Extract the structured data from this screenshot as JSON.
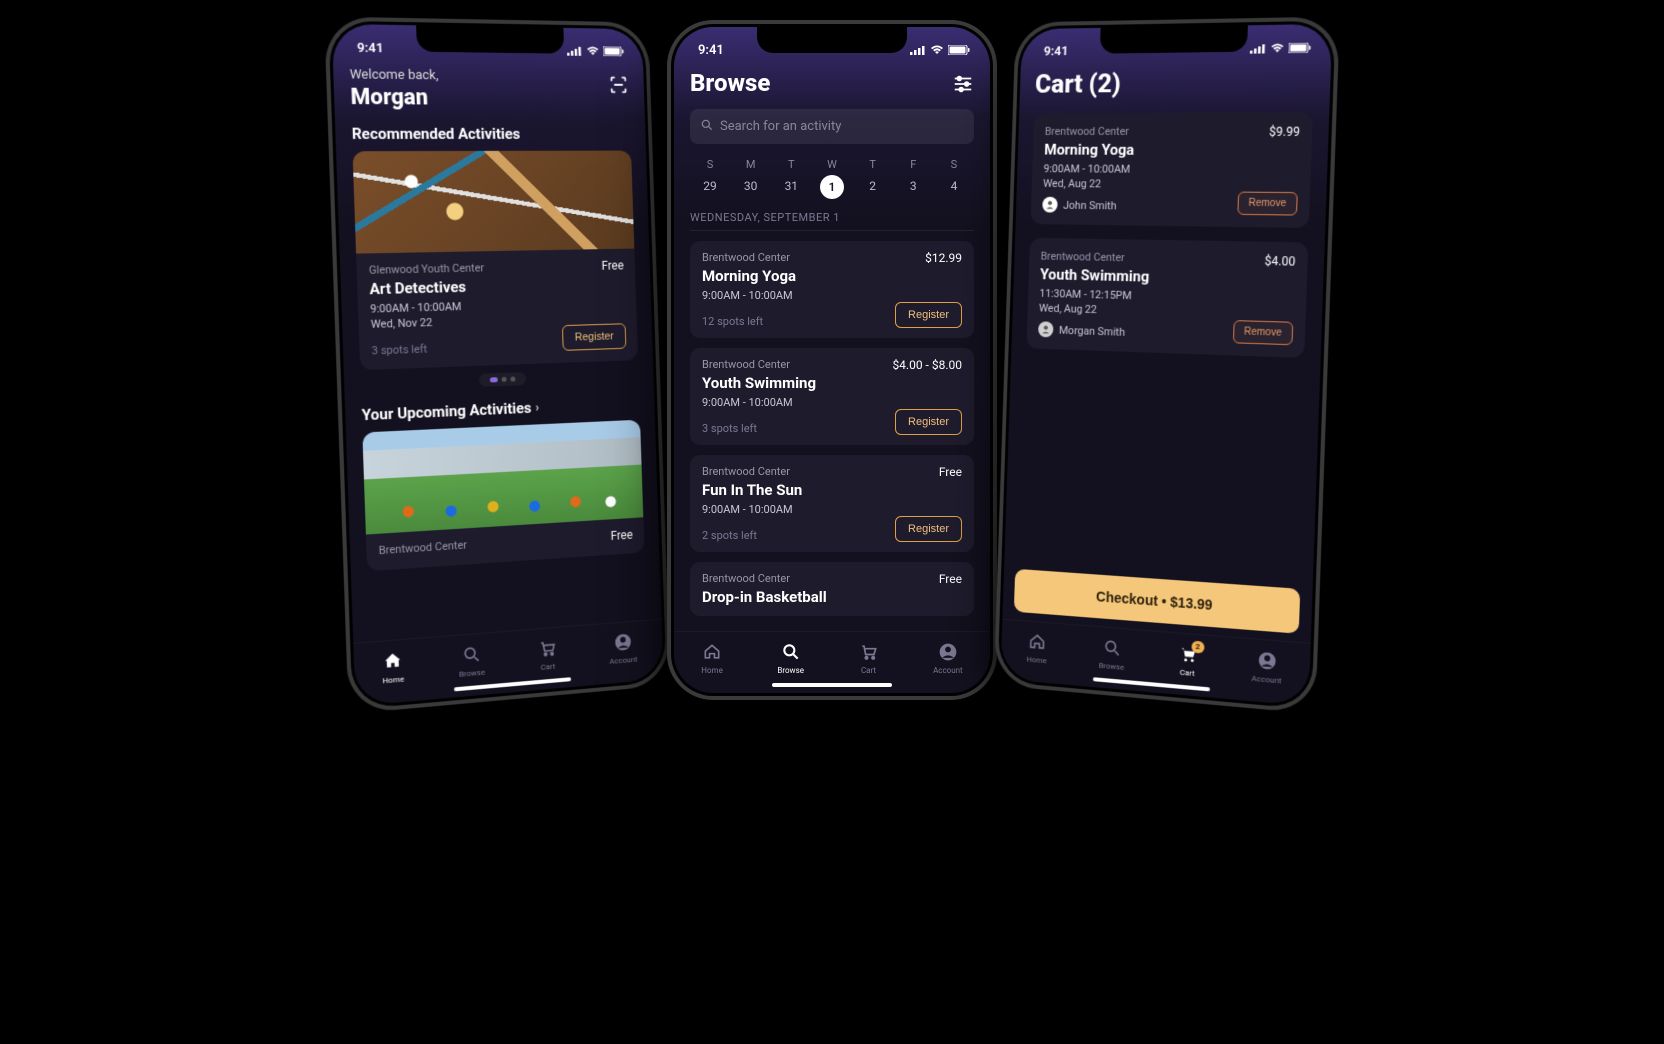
{
  "status": {
    "time": "9:41"
  },
  "tabs": {
    "home": "Home",
    "browse": "Browse",
    "cart": "Cart",
    "account": "Account",
    "cart_badge": "2"
  },
  "home": {
    "welcome": "Welcome back,",
    "name": "Morgan",
    "recommended_title": "Recommended Activities",
    "upcoming_title": "Your Upcoming Activities",
    "card1": {
      "location": "Glenwood Youth Center",
      "price": "Free",
      "title": "Art Detectives",
      "time": "9:00AM - 10:00AM",
      "date": "Wed, Nov 22",
      "spots": "3 spots left",
      "register": "Register"
    },
    "card2": {
      "location": "Brentwood Center",
      "price": "Free"
    }
  },
  "browse": {
    "title": "Browse",
    "search_placeholder": "Search for an activity",
    "weekdays": [
      "S",
      "M",
      "T",
      "W",
      "T",
      "F",
      "S"
    ],
    "days": [
      "29",
      "30",
      "31",
      "1",
      "2",
      "3",
      "4"
    ],
    "selected_index": 3,
    "date_header": "WEDNESDAY, SEPTEMBER 1",
    "items": [
      {
        "location": "Brentwood Center",
        "price": "$12.99",
        "title": "Morning Yoga",
        "time": "9:00AM - 10:00AM",
        "spots": "12 spots left",
        "register": "Register"
      },
      {
        "location": "Brentwood Center",
        "price": "$4.00 - $8.00",
        "title": "Youth Swimming",
        "time": "9:00AM - 10:00AM",
        "spots": "3 spots left",
        "register": "Register"
      },
      {
        "location": "Brentwood Center",
        "price": "Free",
        "title": "Fun In The Sun",
        "time": "9:00AM - 10:00AM",
        "spots": "2 spots left",
        "register": "Register"
      },
      {
        "location": "Brentwood Center",
        "price": "Free",
        "title": "Drop-in Basketball"
      }
    ]
  },
  "cart": {
    "title": "Cart (2)",
    "items": [
      {
        "location": "Brentwood Center",
        "price": "$9.99",
        "title": "Morning Yoga",
        "time": "9:00AM - 10:00AM",
        "date": "Wed, Aug 22",
        "user": "John Smith",
        "remove": "Remove"
      },
      {
        "location": "Brentwood Center",
        "price": "$4.00",
        "title": "Youth Swimming",
        "time": "11:30AM - 12:15PM",
        "date": "Wed, Aug 22",
        "user": "Morgan Smith",
        "remove": "Remove"
      }
    ],
    "checkout": "Checkout • $13.99"
  }
}
